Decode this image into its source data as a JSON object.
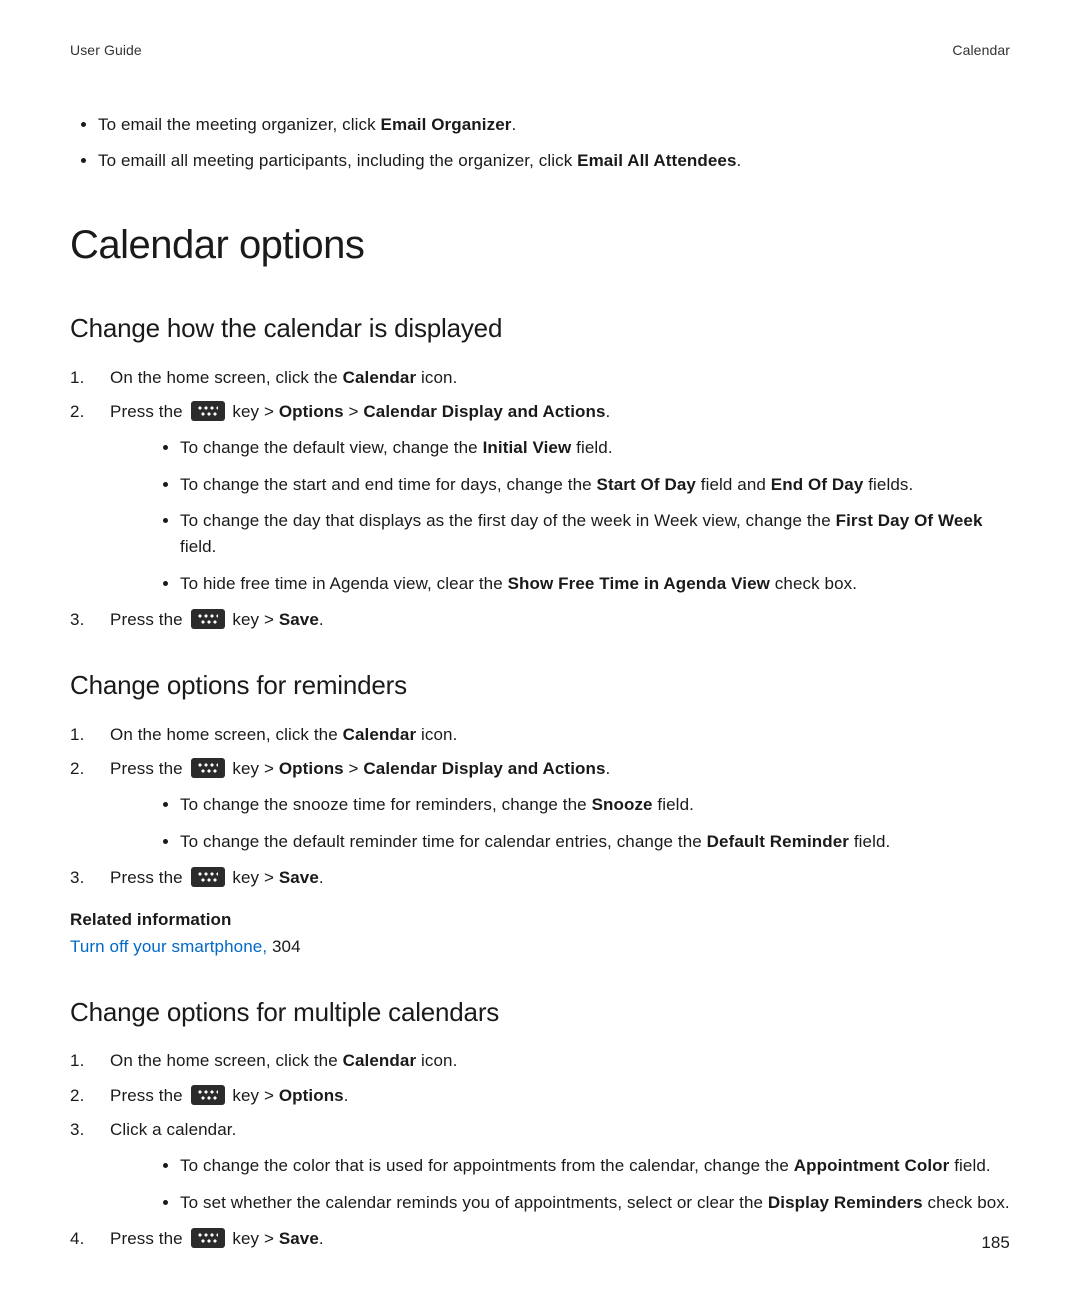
{
  "header": {
    "left": "User Guide",
    "right": "Calendar"
  },
  "intro_bullets": [
    {
      "pre": "To email the meeting organizer, click ",
      "b": "Email Organizer",
      "post": "."
    },
    {
      "pre": "To emaill all meeting participants, including the organizer, click ",
      "b": "Email All Attendees",
      "post": "."
    }
  ],
  "h1": "Calendar options",
  "sec1": {
    "h": "Change how the calendar is displayed",
    "s1": {
      "pre": "On the home screen, click the ",
      "b": "Calendar",
      "post": " icon."
    },
    "s2": {
      "pre": "Press the ",
      "mid": " key > ",
      "b1": "Options",
      "sep": " > ",
      "b2": "Calendar Display and Actions",
      "post": "."
    },
    "sub": [
      {
        "pre": "To change the default view, change the ",
        "b": "Initial View",
        "post": " field."
      },
      {
        "pre": "To change the start and end time for days, change the ",
        "b": "Start Of Day",
        "mid": " field and ",
        "b2": "End Of Day",
        "post": " fields."
      },
      {
        "pre": "To change the day that displays as the first day of the week in Week view, change the ",
        "b": "First Day Of Week",
        "post": " field."
      },
      {
        "pre": "To hide free time in Agenda view, clear the ",
        "b": "Show Free Time in Agenda View",
        "post": " check box."
      }
    ],
    "s3": {
      "pre": "Press the ",
      "mid": " key > ",
      "b": "Save",
      "post": "."
    }
  },
  "sec2": {
    "h": "Change options for reminders",
    "s1": {
      "pre": "On the home screen, click the ",
      "b": "Calendar",
      "post": " icon."
    },
    "s2": {
      "pre": "Press the ",
      "mid": " key > ",
      "b1": "Options",
      "sep": " > ",
      "b2": "Calendar Display and Actions",
      "post": "."
    },
    "sub": [
      {
        "pre": "To change the snooze time for reminders, change the ",
        "b": "Snooze",
        "post": " field."
      },
      {
        "pre": "To change the default reminder time for calendar entries, change the ",
        "b": "Default Reminder",
        "post": " field."
      }
    ],
    "s3": {
      "pre": "Press the ",
      "mid": " key > ",
      "b": "Save",
      "post": "."
    },
    "rel_title": "Related information",
    "rel_link": "Turn off your smartphone,",
    "rel_page": " 304"
  },
  "sec3": {
    "h": "Change options for multiple calendars",
    "s1": {
      "pre": "On the home screen, click the ",
      "b": "Calendar",
      "post": " icon."
    },
    "s2": {
      "pre": "Press the ",
      "mid": " key > ",
      "b": "Options",
      "post": "."
    },
    "s3": "Click a calendar.",
    "sub": [
      {
        "pre": "To change the color that is used for appointments from the calendar, change the ",
        "b": "Appointment Color",
        "post": " field."
      },
      {
        "pre": "To set whether the calendar reminds you of appointments, select or clear the ",
        "b": "Display Reminders",
        "post": " check box."
      }
    ],
    "s4": {
      "pre": "Press the ",
      "mid": " key > ",
      "b": "Save",
      "post": "."
    }
  },
  "page_number": "185"
}
